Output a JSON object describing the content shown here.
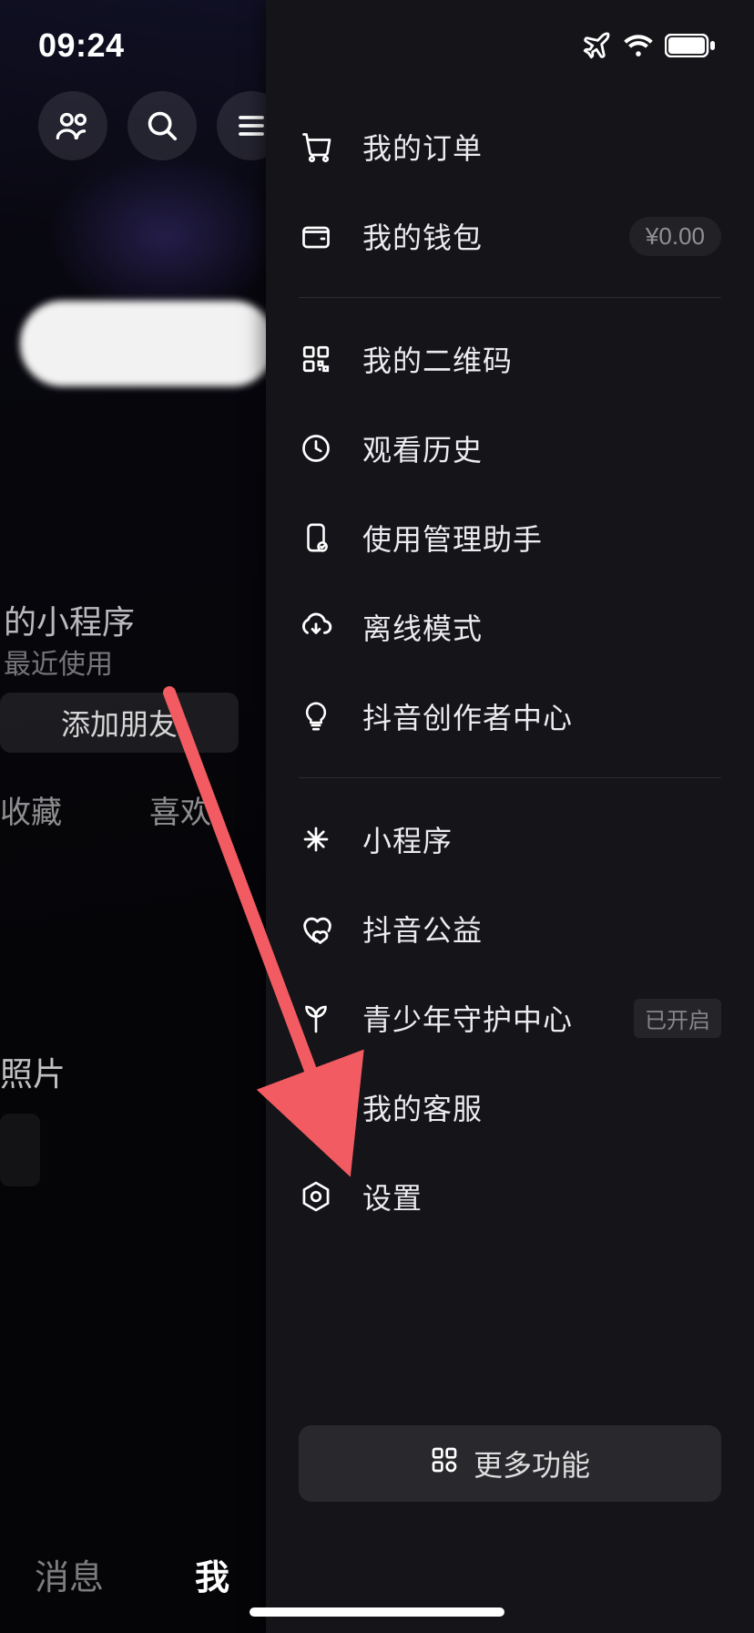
{
  "status": {
    "time": "09:24"
  },
  "bg": {
    "miniprog_title": "的小程序",
    "miniprog_sub": "最近使用",
    "add_friend": "添加朋友",
    "tab_fav": "收藏",
    "tab_like": "喜欢",
    "photo": "照片",
    "bottom_messages": "消息",
    "bottom_me": "我"
  },
  "panel": {
    "orders": "我的订单",
    "wallet": "我的钱包",
    "wallet_amount": "¥0.00",
    "qrcode": "我的二维码",
    "history": "观看历史",
    "usage_assistant": "使用管理助手",
    "offline": "离线模式",
    "creator_center": "抖音创作者中心",
    "miniprog": "小程序",
    "charity": "抖音公益",
    "youth_guard": "青少年守护中心",
    "youth_guard_badge": "已开启",
    "customer_service": "我的客服",
    "settings": "设置",
    "more": "更多功能"
  },
  "annotation": {
    "arrow_color": "#f25b61"
  }
}
